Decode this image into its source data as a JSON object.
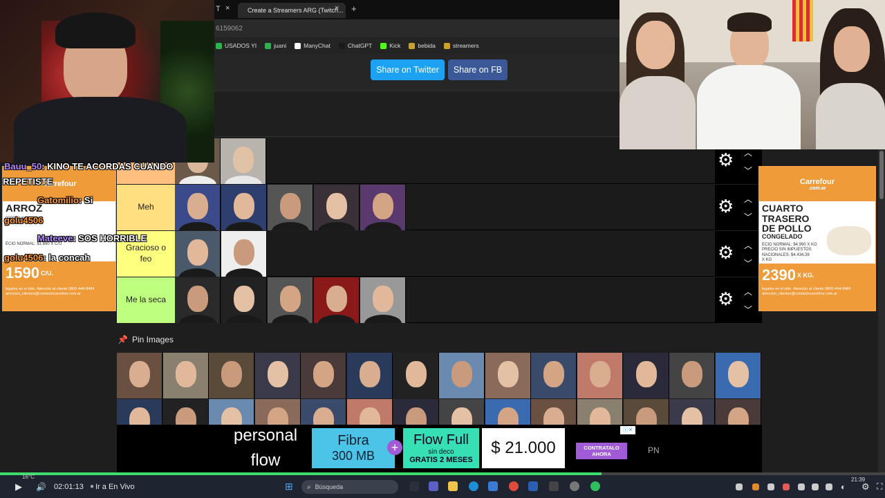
{
  "browser": {
    "tab_title": "Create a Streamers ARG (Twitch...",
    "tab_close": "×",
    "new_tab": "+",
    "url_partial": "6159062",
    "bookmarks": [
      {
        "label": "USADOS YI",
        "color": "#2bb24c"
      },
      {
        "label": "juani",
        "color": "#2bb24c"
      },
      {
        "label": "ManyChat",
        "color": "#ffffff"
      },
      {
        "label": "ChatGPT",
        "color": "#1a1a1a"
      },
      {
        "label": "Kick",
        "color": "#53fc18"
      },
      {
        "label": "bebida",
        "color": "#c9a227"
      },
      {
        "label": "streamers",
        "color": "#c9a227"
      }
    ]
  },
  "share": {
    "twitter_label": "Share on Twitter",
    "twitter_color": "#1da1f2",
    "fb_label": "Share on FB",
    "fb_color": "#3b5998"
  },
  "tiers": [
    {
      "label": "Meh",
      "color": "#ffdf80",
      "count": 5
    },
    {
      "label": "Gracioso o feo",
      "color": "#ffff7f",
      "count": 2
    },
    {
      "label": "Me la seca",
      "color": "#bfff7f",
      "count": 5
    }
  ],
  "pin": {
    "title": "Pin Images",
    "icon": "pushpin-icon"
  },
  "chat": [
    {
      "user": "Bauu_50",
      "message": ": KINO TE ACORDAS CUANDO",
      "user_color": "#b48cff"
    },
    {
      "user": "",
      "message": "REPETISTE",
      "user_color": "#ffffff"
    },
    {
      "user": "Gatomilio",
      "message": ": Si",
      "user_color": "#ff9b3d"
    },
    {
      "user": "golu4506",
      "message": "",
      "user_color": "#ff9b3d"
    },
    {
      "user": "Mateeve",
      "message": ": SOS HORRIBLE",
      "user_color": "#b48cff"
    },
    {
      "user": "golu4506",
      "message": ": la concah",
      "user_color": "#ff9b3d"
    }
  ],
  "ad_left": {
    "brand": "Carrefour",
    "product": "ARROZ",
    "detail": "00000 bolsa x 1 kg.",
    "normal_price": "ECIO NORMAL: $1.690 X C/U",
    "price": "1590",
    "unit": "C/U.",
    "footer": "legales en el sitio. Atención al cliente 0800-444-8484 atencion_clientes@contactocarrefour.com.ar"
  },
  "ad_right": {
    "brand": "Carrefour",
    "brand_sub": ".com.ar",
    "product_l1": "CUARTO",
    "product_l2": "TRASERO",
    "product_l3": "DE POLLO",
    "product_l4": "CONGELADO",
    "normal_price": "ECIO NORMAL: $4.990 X KG",
    "no_tax": "PRECIO SIN IMPUESTOS NACIONALES: $4.434,39 X KG",
    "price": "2390",
    "unit": "X KG.",
    "footer": "legales en el sitio. Atención al cliente 0800-444-8484 atencion_clientes@contactocarrefour.com.ar"
  },
  "banner": {
    "brand_top": "personal",
    "brand_bottom": "flow",
    "fibra_label": "Fibra",
    "fibra_speed": "300 MB",
    "plus": "+",
    "flow_label": "Flow Full",
    "flow_sub": "sin deco",
    "flow_promo": "GRATIS 2 MESES",
    "price": "$ 21.000",
    "cta": "CONTRATALO AHORA",
    "corner": "PN"
  },
  "video": {
    "progress": 0.68,
    "temp": "16°C",
    "time": "02:01:13",
    "live_label": "Ir a En Vivo",
    "search_placeholder": "Búsqueda",
    "clock": "21:39"
  }
}
